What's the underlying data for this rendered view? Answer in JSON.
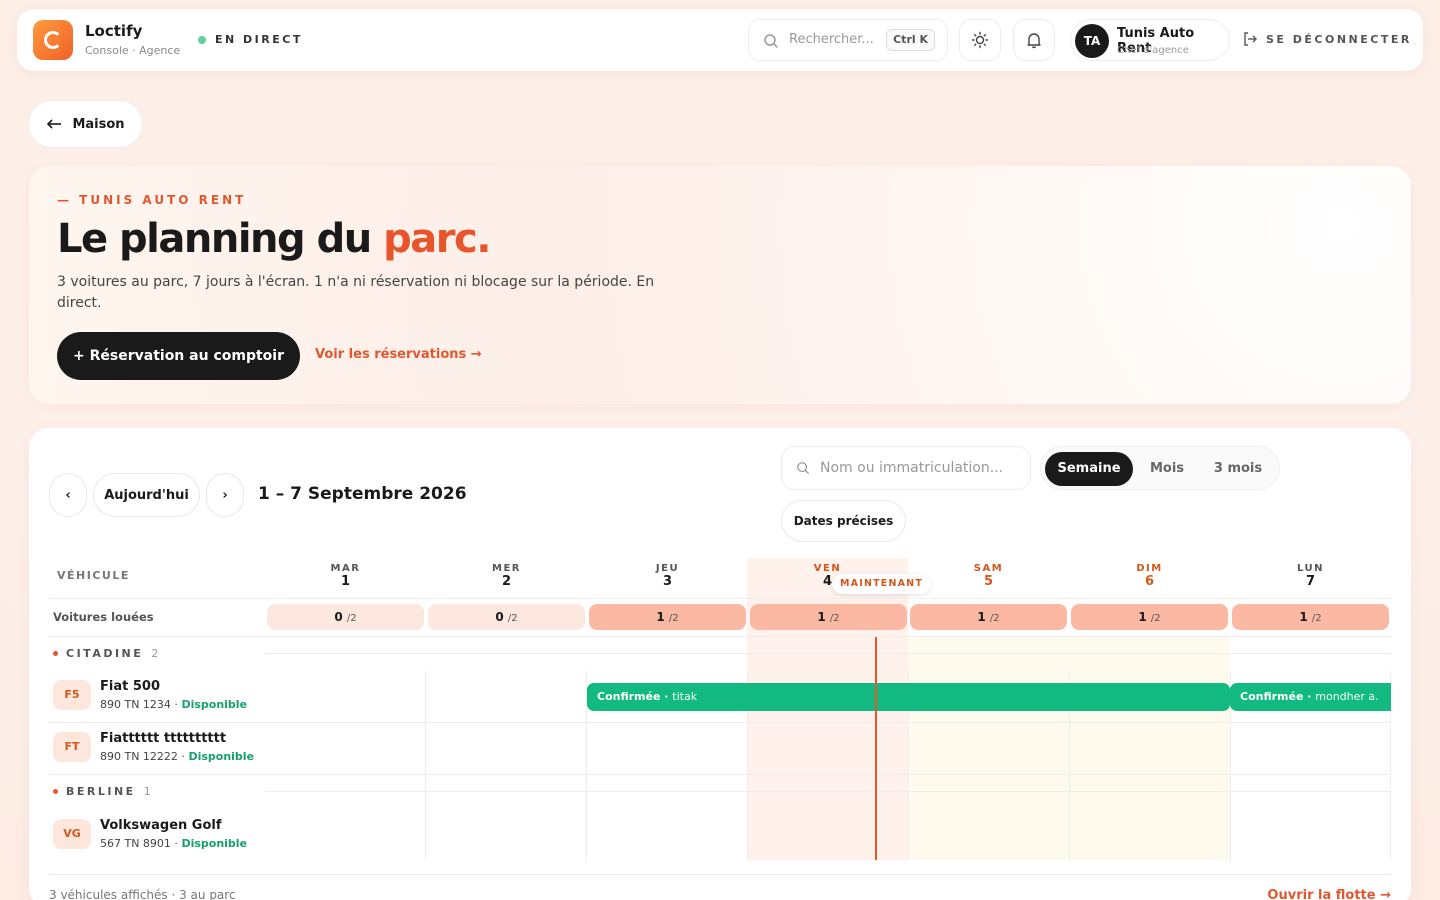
{
  "app": {
    "name": "Loctify",
    "subtitle": "Console · Agence",
    "live": "EN DIRECT"
  },
  "topbar": {
    "search_placeholder": "Rechercher...",
    "shortcut": "Ctrl K",
    "user_initials": "TA",
    "user_name": "Tunis Auto Rent",
    "user_role": "Chef d'agence",
    "logout_label": "SE DÉCONNECTER"
  },
  "back_label": "Maison",
  "hero": {
    "eyebrow": "— TUNIS AUTO RENT",
    "title_main": "Le planning du ",
    "title_accent": "parc.",
    "description": "3 voitures au parc, 7 jours à l'écran. 1 n'a ni réservation ni blocage sur la période. En direct.",
    "cta_label": "+ Réservation au comptoir",
    "link_label": "Voir les réservations →"
  },
  "planning": {
    "prev_label": "‹",
    "today_label": "Aujourd'hui",
    "next_label": "›",
    "range_title": "1 – 7 Septembre 2026",
    "search_placeholder": "Nom ou immatriculation...",
    "views": [
      "Semaine",
      "Mois",
      "3 mois"
    ],
    "active_view": "Semaine",
    "precise_label": "Dates précises",
    "vehicle_header": "VÉHICULE",
    "now_label": "MAINTENANT",
    "rented_label": "Voitures louées",
    "days": [
      {
        "name": "MAR",
        "num": "1",
        "count": "0",
        "total": "/2"
      },
      {
        "name": "MER",
        "num": "2",
        "count": "0",
        "total": "/2"
      },
      {
        "name": "JEU",
        "num": "3",
        "count": "1",
        "total": "/2"
      },
      {
        "name": "VEN",
        "num": "4",
        "count": "1",
        "total": "/2"
      },
      {
        "name": "SAM",
        "num": "5",
        "count": "1",
        "total": "/2"
      },
      {
        "name": "DIM",
        "num": "6",
        "count": "1",
        "total": "/2"
      },
      {
        "name": "LUN",
        "num": "7",
        "count": "1",
        "total": "/2"
      }
    ],
    "groups": [
      {
        "name": "CITADINE",
        "count": "2",
        "vehicles": [
          {
            "code": "F5",
            "name": "Fiat 500",
            "plate": "890 TN 1234",
            "status": "Disponible"
          },
          {
            "code": "FT",
            "name": "Fiatttttt tttttttttt",
            "plate": "890 TN 12222",
            "status": "Disponible"
          }
        ]
      },
      {
        "name": "BERLINE",
        "count": "1",
        "vehicles": [
          {
            "code": "VG",
            "name": "Volkswagen Golf",
            "plate": "567 TN 8901",
            "status": "Disponible"
          }
        ]
      }
    ],
    "bookings": [
      {
        "status": "Confirmée",
        "customer": "titak"
      },
      {
        "status": "Confirmée",
        "customer": "mondher a."
      }
    ],
    "footer_left": "3 véhicules affichés · 3 au parc",
    "footer_right": "Ouvrir la flotte →"
  },
  "colors": {
    "accent": "#e8552b",
    "booking": "#12b981",
    "available": "#16a06a"
  }
}
